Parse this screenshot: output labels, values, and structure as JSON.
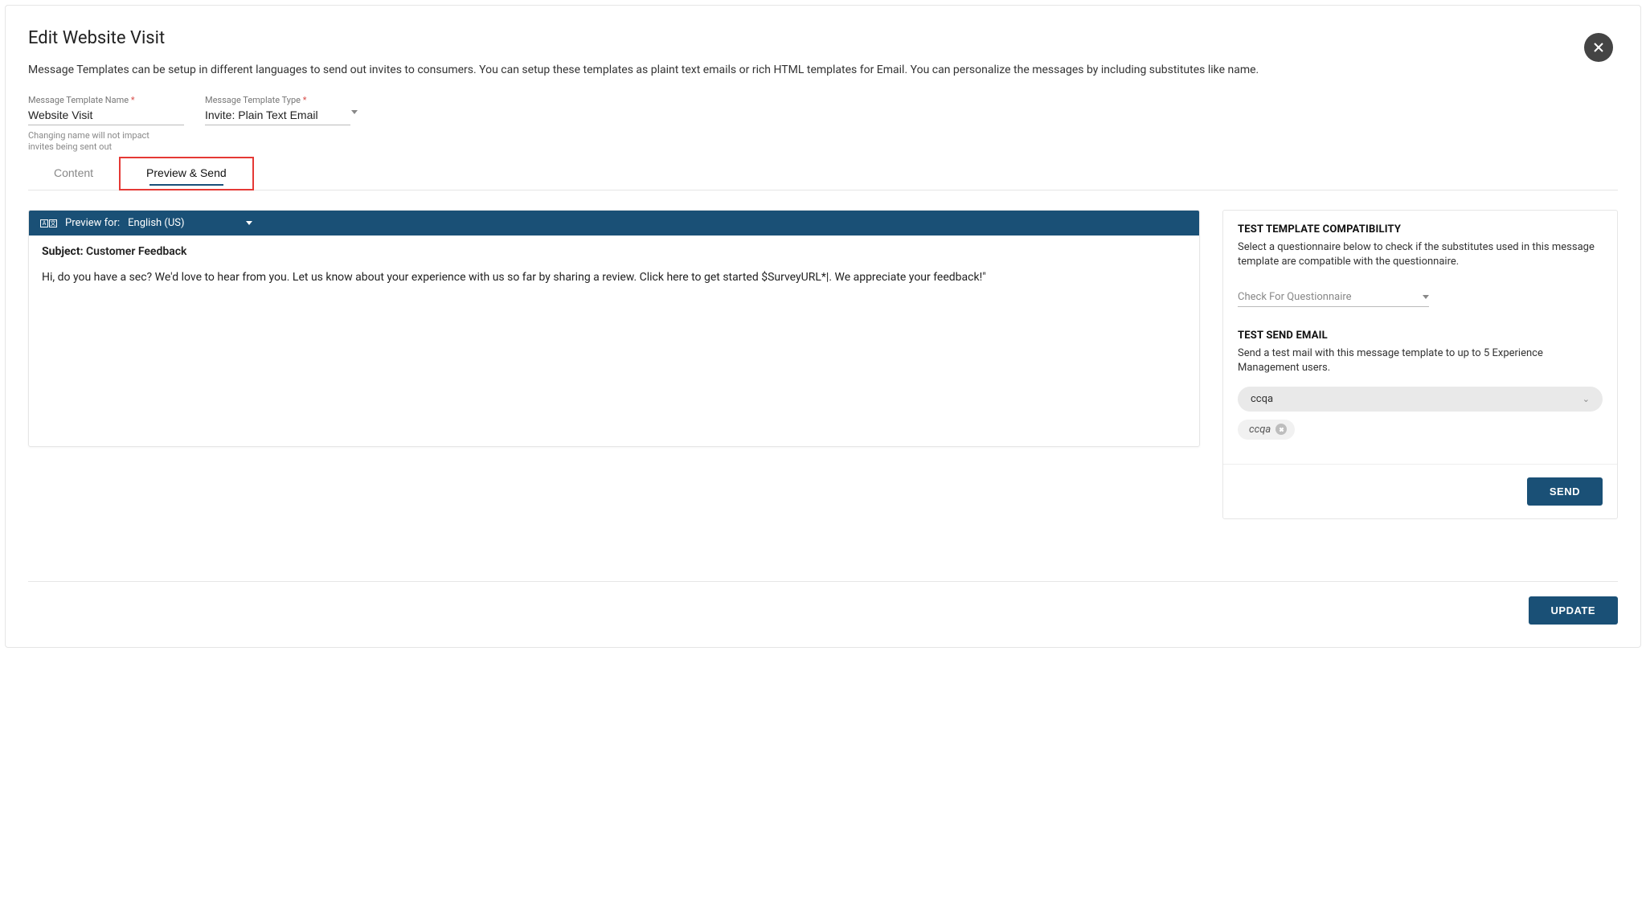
{
  "header": {
    "title": "Edit Website Visit",
    "description": "Message Templates can be setup in different languages to send out invites to consumers. You can setup these templates as plaint text emails or rich HTML templates for Email. You can personalize the messages by including substitutes like name."
  },
  "fields": {
    "name": {
      "label": "Message Template Name",
      "value": "Website Visit",
      "helper": "Changing name will not impact invites being sent out"
    },
    "type": {
      "label": "Message Template Type",
      "value": "Invite: Plain Text Email"
    }
  },
  "tabs": {
    "content": "Content",
    "preview": "Preview & Send"
  },
  "preview": {
    "preview_for_label": "Preview for:",
    "language": "English (US)",
    "subject_label": "Subject:",
    "subject_value": "Customer Feedback",
    "body": "Hi, do you have a sec? We'd love to hear from you. Let us know about your experience with us so far by sharing a review. Click here to get started $SurveyURL*|. We appreciate your feedback!\""
  },
  "side": {
    "compat_title": "TEST TEMPLATE COMPATIBILITY",
    "compat_desc": "Select a questionnaire below to check if the substitutes used in this message template are compatible with the questionnaire.",
    "questionnaire_placeholder": "Check For Questionnaire",
    "testsend_title": "TEST SEND EMAIL",
    "testsend_desc": "Send a test mail with this message template to up to 5 Experience Management users.",
    "user_select_value": "ccqa",
    "chip_value": "ccqa",
    "send_label": "SEND"
  },
  "footer": {
    "update_label": "UPDATE"
  }
}
